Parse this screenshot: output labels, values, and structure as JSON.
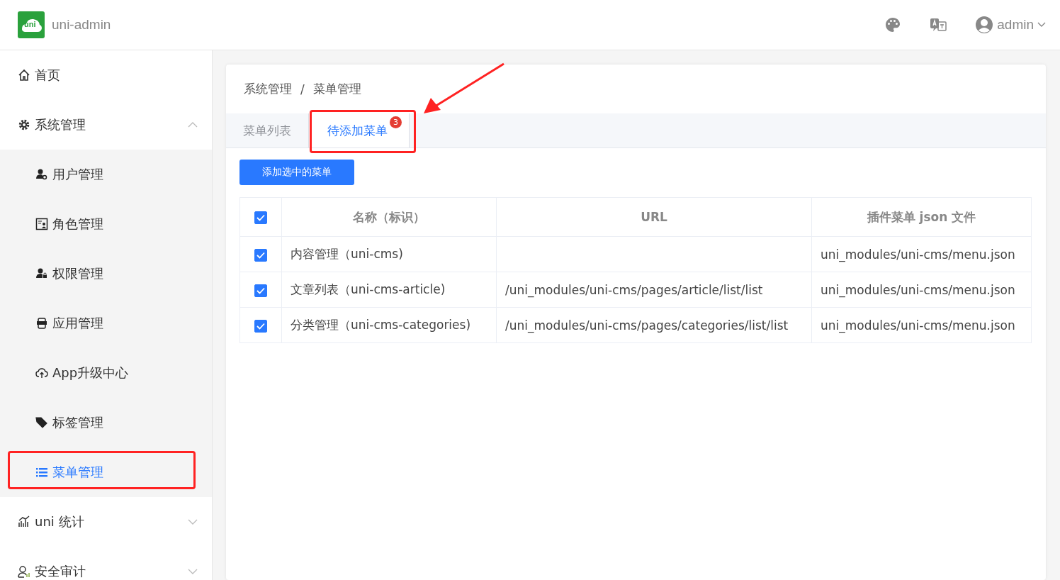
{
  "header": {
    "logo": "uni",
    "title": "uni-admin",
    "user": "admin"
  },
  "sidebar": {
    "items": [
      {
        "label": "首页",
        "selected": false
      },
      {
        "label": "系统管理",
        "selected": false,
        "expanded": true,
        "children": [
          {
            "label": "用户管理",
            "selected": false
          },
          {
            "label": "角色管理",
            "selected": false
          },
          {
            "label": "权限管理",
            "selected": false
          },
          {
            "label": "应用管理",
            "selected": false
          },
          {
            "label": "App升级中心",
            "selected": false
          },
          {
            "label": "标签管理",
            "selected": false
          },
          {
            "label": "菜单管理",
            "selected": true
          }
        ]
      },
      {
        "label": "uni 统计",
        "selected": false,
        "expanded": false
      },
      {
        "label": "安全审计",
        "selected": false,
        "expanded": false
      }
    ]
  },
  "breadcrumb": [
    "系统管理",
    "/",
    "菜单管理"
  ],
  "tabs": [
    {
      "label": "菜单列表",
      "selected": false
    },
    {
      "label": "待添加菜单",
      "selected": true,
      "badge": "3"
    }
  ],
  "add_button": "添加选中的菜单",
  "table": {
    "all_checked": true,
    "columns": [
      "名称（标识）",
      "URL",
      "插件菜单 json 文件"
    ],
    "rows": [
      {
        "checked": true,
        "cells": [
          "内容管理（uni-cms)",
          "",
          "uni_modules/uni-cms/menu.json"
        ]
      },
      {
        "checked": true,
        "cells": [
          "文章列表（uni-cms-article)",
          "/uni_modules/uni-cms/pages/article/list/list",
          "uni_modules/uni-cms/menu.json"
        ]
      },
      {
        "checked": true,
        "cells": [
          "分类管理（uni-cms-categories)",
          "/uni_modules/uni-cms/pages/categories/list/list",
          "uni_modules/uni-cms/menu.json"
        ]
      }
    ]
  }
}
